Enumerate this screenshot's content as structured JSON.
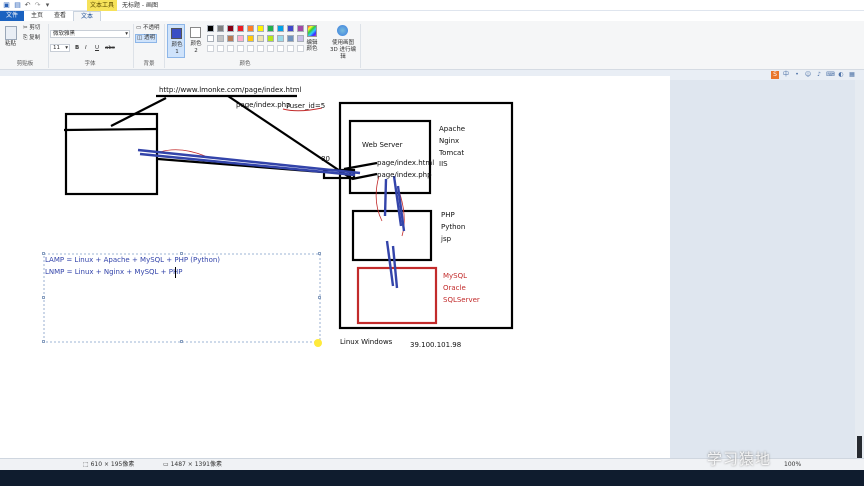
{
  "titlebar": {
    "context_tab": "文本工具",
    "title": "无标题 - 画图"
  },
  "tabs": [
    {
      "label": "文件"
    },
    {
      "label": "主页"
    },
    {
      "label": "查看"
    },
    {
      "label": "文本"
    }
  ],
  "ribbon": {
    "clipboard": {
      "paste": "粘贴",
      "cut": "剪切",
      "copy": "复制",
      "group": "剪贴板"
    },
    "font": {
      "family": "微软雅黑",
      "size": "11",
      "bold": "B",
      "italic": "I",
      "underline": "U",
      "strike": "abc",
      "group": "字体"
    },
    "background": {
      "opaque": "不透明",
      "transparent": "透明",
      "group": "背景"
    },
    "colors": {
      "color1": "颜色 1",
      "color2": "颜色 2",
      "edit": "编辑颜色",
      "paint3d": "使用画图 3D 进行编辑",
      "group": "颜色",
      "color1_value": "#3a4ec4",
      "color2_value": "#ffffff",
      "row1": [
        "#000000",
        "#7f7f7f",
        "#880015",
        "#ed1c24",
        "#ff7f27",
        "#fff200",
        "#22b14c",
        "#00a2e8",
        "#3f48cc",
        "#a349a4"
      ],
      "row2": [
        "#ffffff",
        "#c3c3c3",
        "#b97a57",
        "#ffaec9",
        "#ffc90e",
        "#efe4b0",
        "#b5e61d",
        "#99d9ea",
        "#7092be",
        "#c8bfe7"
      ]
    }
  },
  "canvas": {
    "url_text": "http://www.lmonke.com/page/index.html",
    "path_text": "page/index.php",
    "query_text": "?user_id=5",
    "port_text": "80",
    "web_server": "Web Server",
    "servers": [
      "Apache",
      "Nginx",
      "Tomcat",
      "IIS"
    ],
    "page_html": "page/index.html",
    "page_php": "page/index.php",
    "langs": [
      "PHP",
      "Python",
      "jsp"
    ],
    "dbs": [
      "MySQL",
      "Oracle",
      "SQLServer"
    ],
    "os_text": "Linux   Windows",
    "ip_text": "39.100.101.98",
    "lamp": "LAMP =  Linux  + Apache + MySQL + PHP (Python)",
    "lnmp": "LNMP = Linux + Nginx  + MySQL + PHP",
    "ink_black": "#000000",
    "ink_blue": "#3344aa",
    "ink_red": "#c22b2b"
  },
  "status": {
    "selection": "610 × 195像素",
    "canvas_size": "1487 × 1391像素",
    "zoom": "100%"
  },
  "watermark": "学习猿地"
}
